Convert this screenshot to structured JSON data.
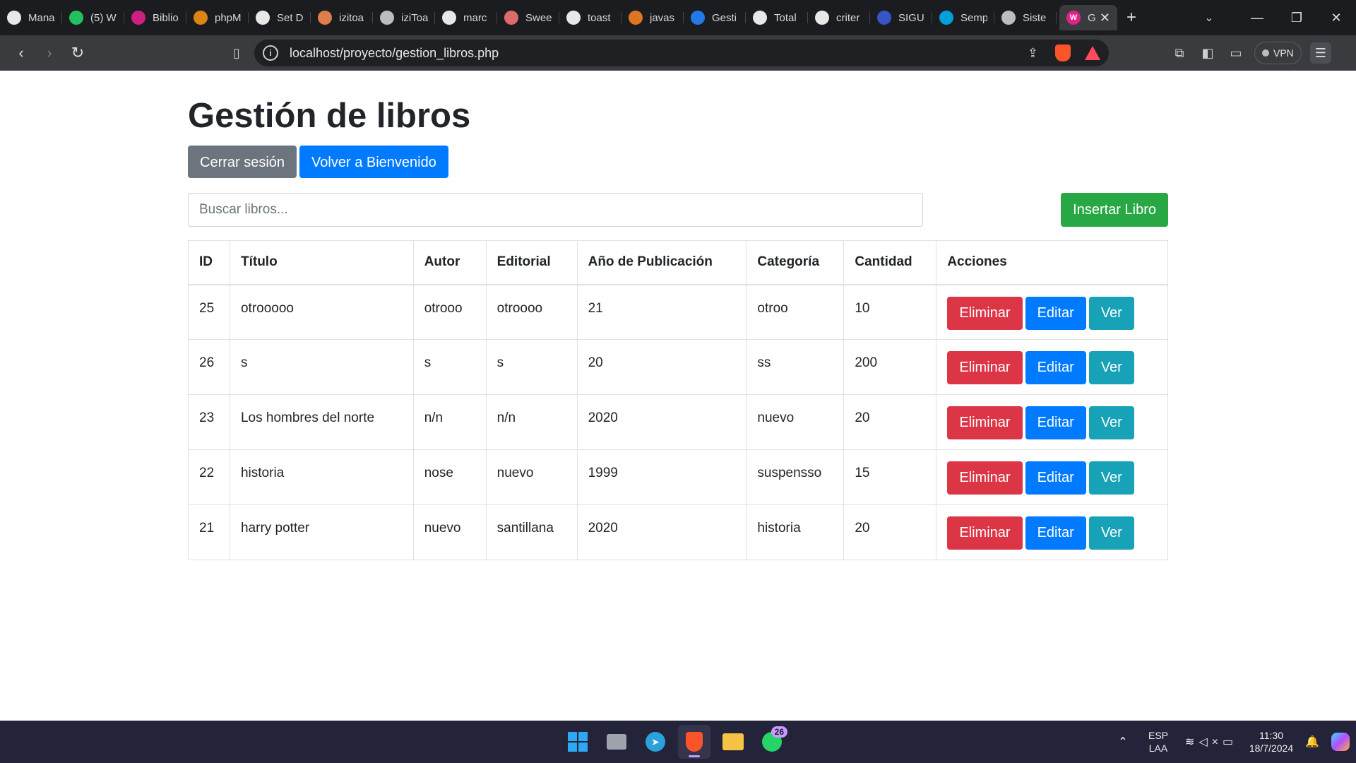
{
  "browser": {
    "tabs": [
      {
        "title": "Mana",
        "icon": "github-icon",
        "color": "#ffffff"
      },
      {
        "title": "(5) W",
        "icon": "whatsapp-icon",
        "color": "#25d366"
      },
      {
        "title": "Biblio",
        "icon": "app-icon",
        "color": "#e0218a"
      },
      {
        "title": "phpM",
        "icon": "phpmyadmin-icon",
        "color": "#f29111"
      },
      {
        "title": "Set D",
        "icon": "chatgpt-icon",
        "color": "#ffffff"
      },
      {
        "title": "izitoa",
        "icon": "code-icon",
        "color": "#f28b50"
      },
      {
        "title": "iziToa",
        "icon": "globe-icon",
        "color": "#cfcfcf"
      },
      {
        "title": "marc",
        "icon": "github-icon",
        "color": "#ffffff"
      },
      {
        "title": "Swee",
        "icon": "sweetalert-icon",
        "color": "#f27474"
      },
      {
        "title": "toast",
        "icon": "google-icon",
        "color": "#ffffff"
      },
      {
        "title": "javas",
        "icon": "stackoverflow-icon",
        "color": "#f48024"
      },
      {
        "title": "Gesti",
        "icon": "jira-icon",
        "color": "#2684ff"
      },
      {
        "title": "Total",
        "icon": "chatgpt-icon",
        "color": "#ffffff"
      },
      {
        "title": "criter",
        "icon": "google-icon",
        "color": "#ffffff"
      },
      {
        "title": "SIGU",
        "icon": "sigu-icon",
        "color": "#3b5bdb"
      },
      {
        "title": "Semp",
        "icon": "skype-icon",
        "color": "#00aff0"
      },
      {
        "title": "Siste",
        "icon": "globe-icon",
        "color": "#cfcfcf"
      }
    ],
    "active_tab": {
      "title": "G",
      "icon": "app-icon",
      "color": "#e0218a"
    },
    "url": "localhost/proyecto/gestion_libros.php",
    "vpn_label": "VPN"
  },
  "page": {
    "title": "Gestión de libros",
    "logout_label": "Cerrar sesión",
    "back_label": "Volver a Bienvenido",
    "search_placeholder": "Buscar libros...",
    "insert_label": "Insertar Libro",
    "columns": [
      "ID",
      "Título",
      "Autor",
      "Editorial",
      "Año de Publicación",
      "Categoría",
      "Cantidad",
      "Acciones"
    ],
    "rows": [
      {
        "id": "25",
        "titulo": "otrooooo",
        "autor": "otrooo",
        "editorial": "otroooo",
        "anio": "21",
        "categoria": "otroo",
        "cantidad": "10"
      },
      {
        "id": "26",
        "titulo": "s",
        "autor": "s",
        "editorial": "s",
        "anio": "20",
        "categoria": "ss",
        "cantidad": "200"
      },
      {
        "id": "23",
        "titulo": "Los hombres del norte",
        "autor": "n/n",
        "editorial": "n/n",
        "anio": "2020",
        "categoria": "nuevo",
        "cantidad": "20"
      },
      {
        "id": "22",
        "titulo": "historia",
        "autor": "nose",
        "editorial": "nuevo",
        "anio": "1999",
        "categoria": "suspensso",
        "cantidad": "15"
      },
      {
        "id": "21",
        "titulo": "harry potter",
        "autor": "nuevo",
        "editorial": "santillana",
        "anio": "2020",
        "categoria": "historia",
        "cantidad": "20"
      }
    ],
    "actions": {
      "delete": "Eliminar",
      "edit": "Editar",
      "view": "Ver"
    }
  },
  "taskbar": {
    "apps": [
      "windows-start-icon",
      "file-explorer-icon",
      "telegram-icon",
      "brave-icon",
      "folder-icon",
      "whatsapp-icon"
    ],
    "whatsapp_badge": "26",
    "lang_top": "ESP",
    "lang_bottom": "LAA",
    "time": "11:30",
    "date": "18/7/2024"
  }
}
